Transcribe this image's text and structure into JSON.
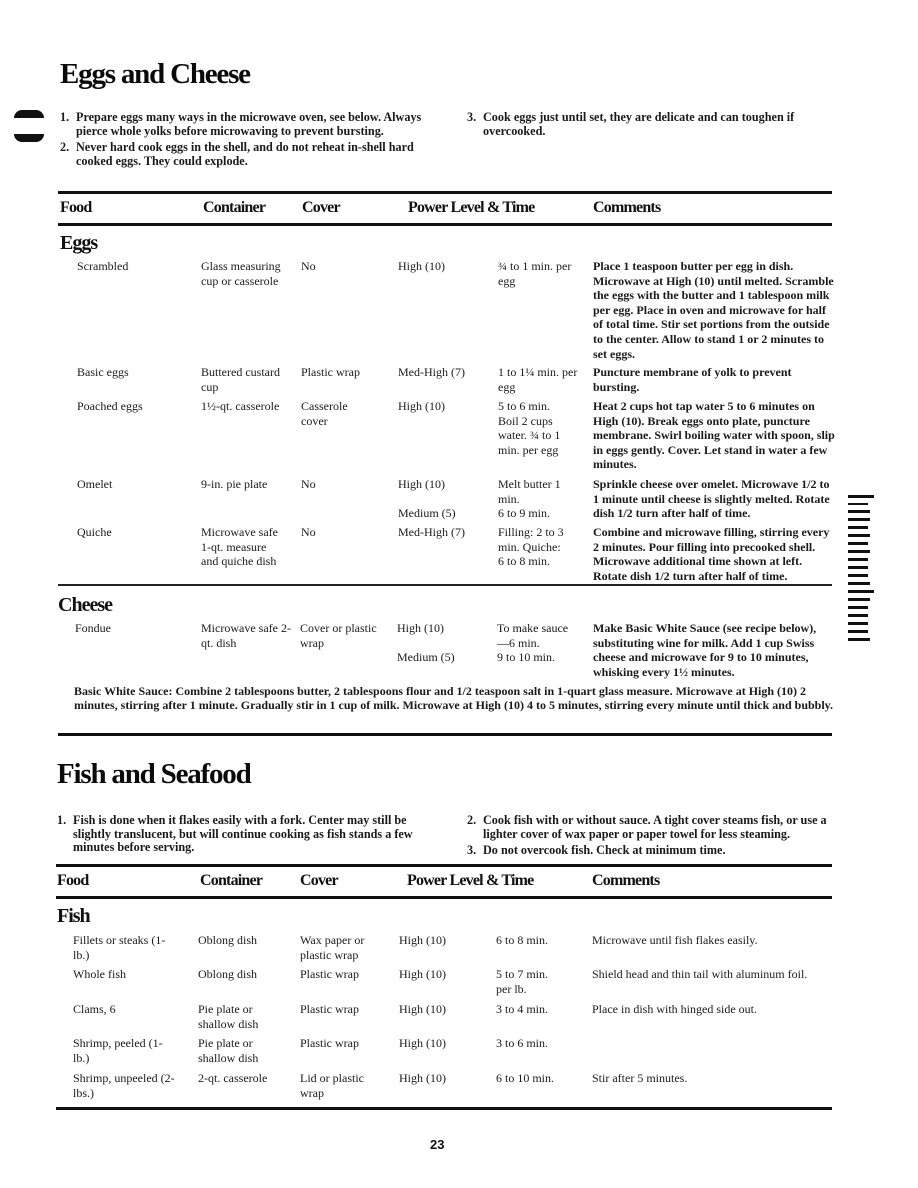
{
  "page_number": "23",
  "eggs_section": {
    "title": "Eggs and Cheese",
    "intro": [
      {
        "num": "1.",
        "text": "Prepare eggs many ways in the microwave oven, see below. Always pierce whole yolks before microwaving to prevent bursting."
      },
      {
        "num": "2.",
        "text": "Never hard cook eggs in the shell, and do not reheat in-shell hard cooked eggs. They could explode."
      },
      {
        "num": "3.",
        "text": "Cook eggs just until set, they are delicate and can toughen if overcooked."
      }
    ],
    "headers": {
      "food": "Food",
      "container": "Container",
      "cover": "Cover",
      "power": "Power Level & Time",
      "comments": "Comments"
    },
    "eggs_heading": "Eggs",
    "eggs_rows": [
      {
        "food": "Scrambled",
        "container": "Glass measuring cup or casserole",
        "cover": "No",
        "power": "High (10)",
        "time": "¾ to 1 min. per egg",
        "comments": "Place 1 teaspoon butter per egg in dish. Microwave at High (10) until melted. Scramble the eggs with the butter and 1 tablespoon milk per egg. Place in oven and microwave for half of total time. Stir set portions from the outside to the center. Allow to stand 1 or 2 minutes to set eggs."
      },
      {
        "food": "Basic eggs",
        "container": "Buttered custard cup",
        "cover": "Plastic wrap",
        "power": "Med-High (7)",
        "time": "1 to 1¼ min. per egg",
        "comments": "Puncture membrane of yolk to prevent bursting."
      },
      {
        "food": "Poached eggs",
        "container": "1½-qt. casserole",
        "cover": "Casserole cover",
        "power": "High (10)",
        "time": "5 to 6 min. Boil 2 cups water. ¾ to 1 min. per egg",
        "comments": "Heat 2 cups hot tap water 5 to 6 minutes on High (10). Break eggs onto plate, puncture membrane. Swirl boiling water with spoon, slip in eggs gently. Cover. Let stand in water a few minutes."
      },
      {
        "food": "Omelet",
        "container": "9-in. pie plate",
        "cover": "No",
        "power": "High (10)",
        "power2": "Medium (5)",
        "time": "Melt butter 1 min.",
        "time2": "6 to 9 min.",
        "comments": "Sprinkle cheese over omelet. Microwave 1/2 to 1 minute until cheese is slightly melted. Rotate dish 1/2 turn after half of time."
      },
      {
        "food": "Quiche",
        "container": "Microwave safe 1-qt. measure and quiche dish",
        "cover": "No",
        "power": "Med-High (7)",
        "time": "Filling: 2 to 3 min. Quiche: 6 to 8 min.",
        "comments": "Combine and microwave filling, stirring every 2 minutes. Pour filling into precooked shell. Microwave additional time shown at left. Rotate dish 1/2 turn after half of time."
      }
    ],
    "cheese_heading": "Cheese",
    "cheese_rows": [
      {
        "food": "Fondue",
        "container": "Microwave safe 2-qt. dish",
        "cover": "Cover or plastic wrap",
        "power": "High (10)",
        "power2": "Medium (5)",
        "time": "To make sauce—6 min.",
        "time2": "9 to 10 min.",
        "comments": "Make Basic White Sauce (see recipe below), substituting wine for milk. Add 1 cup Swiss cheese and microwave for 9 to 10 minutes, whisking every 1½ minutes."
      }
    ],
    "note": "Basic White Sauce: Combine 2 tablespoons butter, 2 tablespoons flour and 1/2 teaspoon salt in 1-quart glass measure. Microwave at High (10) 2 minutes, stirring after 1 minute. Gradually stir in 1 cup of milk. Microwave at High (10) 4 to 5 minutes, stirring every minute until thick and bubbly."
  },
  "fish_section": {
    "title": "Fish and Seafood",
    "intro": [
      {
        "num": "1.",
        "text": "Fish is done when it flakes easily with a fork. Center may still be slightly translucent, but will continue cooking as fish stands a few minutes before serving."
      },
      {
        "num": "2.",
        "text": "Cook fish with or without sauce. A tight cover steams fish, or use a lighter cover of wax paper or paper towel for less steaming."
      },
      {
        "num": "3.",
        "text": "Do not overcook fish. Check at minimum time."
      }
    ],
    "headers": {
      "food": "Food",
      "container": "Container",
      "cover": "Cover",
      "power": "Power Level & Time",
      "comments": "Comments"
    },
    "fish_heading": "Fish",
    "rows": [
      {
        "food": "Fillets or steaks (1-lb.)",
        "container": "Oblong dish",
        "cover": "Wax paper or plastic wrap",
        "power": "High (10)",
        "time": "6 to 8 min.",
        "comments": "Microwave until fish flakes easily."
      },
      {
        "food": "Whole fish",
        "container": "Oblong dish",
        "cover": "Plastic wrap",
        "power": "High (10)",
        "time": "5 to 7 min. per lb.",
        "comments": "Shield head and thin tail with aluminum foil."
      },
      {
        "food": "Clams, 6",
        "container": "Pie plate or shallow dish",
        "cover": "Plastic wrap",
        "power": "High (10)",
        "time": "3 to 4 min.",
        "comments": "Place in dish with hinged side out."
      },
      {
        "food": "Shrimp, peeled (1-lb.)",
        "container": "Pie plate or shallow dish",
        "cover": "Plastic wrap",
        "power": "High (10)",
        "time": "3 to 6 min.",
        "comments": ""
      },
      {
        "food": "Shrimp, unpeeled (2-lbs.)",
        "container": "2-qt. casserole",
        "cover": "Lid or plastic wrap",
        "power": "High (10)",
        "time": "6 to 10 min.",
        "comments": "Stir after 5 minutes."
      }
    ]
  }
}
